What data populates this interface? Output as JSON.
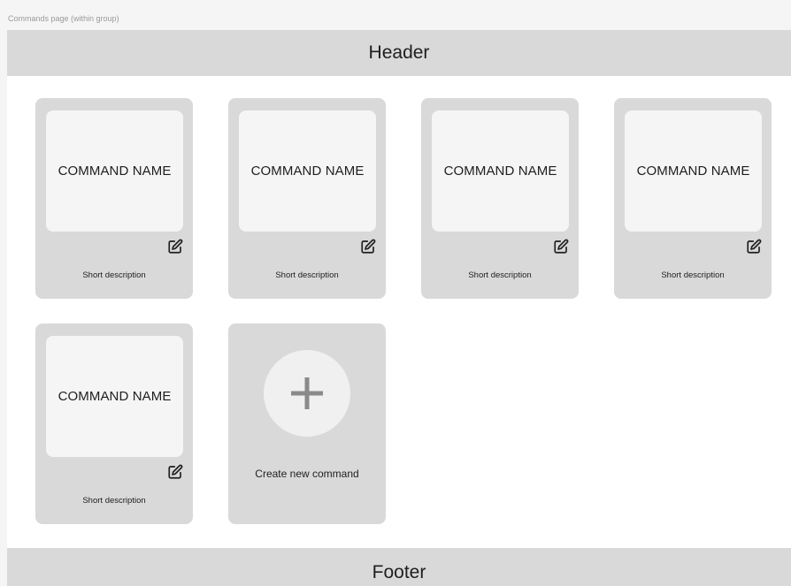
{
  "frame_label": "Commands page (within group)",
  "header": {
    "title": "Header"
  },
  "footer": {
    "title": "Footer"
  },
  "commands": [
    {
      "name": "COMMAND NAME",
      "description": "Short description",
      "edit_icon": "edit-icon"
    },
    {
      "name": "COMMAND NAME",
      "description": "Short description",
      "edit_icon": "edit-icon"
    },
    {
      "name": "COMMAND NAME",
      "description": "Short description",
      "edit_icon": "edit-icon"
    },
    {
      "name": "COMMAND NAME",
      "description": "Short description",
      "edit_icon": "edit-icon"
    },
    {
      "name": "COMMAND NAME",
      "description": "Short description",
      "edit_icon": "edit-icon"
    }
  ],
  "create_card": {
    "label": "Create new command",
    "icon": "plus-icon"
  },
  "colors": {
    "card_bg": "#d9d9d9",
    "name_box_bg": "#f5f5f5",
    "bar_bg": "#d9d9d9",
    "plus_color": "#8a8a8a"
  }
}
